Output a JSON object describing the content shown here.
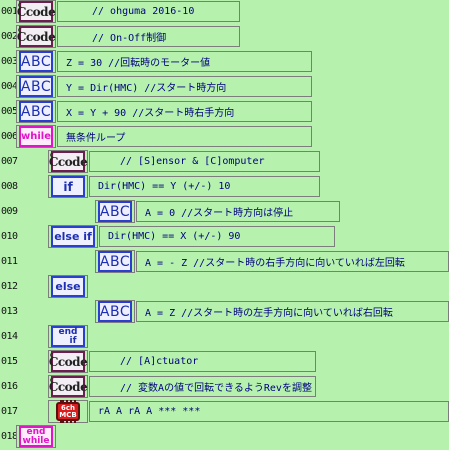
{
  "program": {
    "rows": [
      {
        "no": "001",
        "kind": "ccode",
        "icon_label": "Ccode",
        "text": "// ohguma 2016-10"
      },
      {
        "no": "002",
        "kind": "ccode",
        "icon_label": "Ccode",
        "text": "// On-Off制御"
      },
      {
        "no": "003",
        "kind": "abc",
        "icon_label": "ABC",
        "text": "Z = 30  //回転時のモーター値"
      },
      {
        "no": "004",
        "kind": "abc",
        "icon_label": "ABC",
        "text": "Y = Dir(HMC)  //スタート時方向"
      },
      {
        "no": "005",
        "kind": "abc",
        "icon_label": "ABC",
        "text": "X = Y + 90  //スタート時右手方向"
      },
      {
        "no": "006",
        "kind": "while",
        "icon_label": "while",
        "text": "無条件ループ"
      },
      {
        "no": "007",
        "kind": "ccode",
        "icon_label": "Ccode",
        "text": "// [S]ensor & [C]omputer"
      },
      {
        "no": "008",
        "kind": "if",
        "icon_label": "if",
        "text": "Dir(HMC) == Y (+/-) 10"
      },
      {
        "no": "009",
        "kind": "abc",
        "icon_label": "ABC",
        "text": "A = 0  //スタート時方向は停止"
      },
      {
        "no": "010",
        "kind": "elseif",
        "icon_label": "else if",
        "text": "Dir(HMC) == X (+/-) 90"
      },
      {
        "no": "011",
        "kind": "abc",
        "icon_label": "ABC",
        "text": "A = - Z  //スタート時の右手方向に向いていれば左回転"
      },
      {
        "no": "012",
        "kind": "else",
        "icon_label": "else",
        "text": ""
      },
      {
        "no": "013",
        "kind": "abc",
        "icon_label": "ABC",
        "text": "A = Z  //スタート時の左手方向に向いていれば右回転"
      },
      {
        "no": "014",
        "kind": "endif",
        "icon_label": "end if",
        "icon_top": "end",
        "icon_bottom": "if",
        "text": ""
      },
      {
        "no": "015",
        "kind": "ccode",
        "icon_label": "Ccode",
        "text": "// [A]ctuator"
      },
      {
        "no": "016",
        "kind": "ccode",
        "icon_label": "Ccode",
        "text": "// 変数Aの値で回転できるようRevを調整"
      },
      {
        "no": "017",
        "kind": "mcb",
        "icon_label": "6ch MCB",
        "icon_top": "6ch",
        "icon_bottom": "MCB",
        "text": "rA    A    rA    A    ***   ***"
      },
      {
        "no": "018",
        "kind": "endwhile",
        "icon_label": "end while",
        "icon_top": "end",
        "icon_bottom": "while",
        "text": ""
      }
    ]
  },
  "colors": {
    "background": "#b6f2ae",
    "ccode_border": "#6b1f4e",
    "blue_block": "#2a3fd0",
    "while_block": "#e015c8",
    "mcb_red": "#d81e1e",
    "text_navy": "#000080"
  }
}
